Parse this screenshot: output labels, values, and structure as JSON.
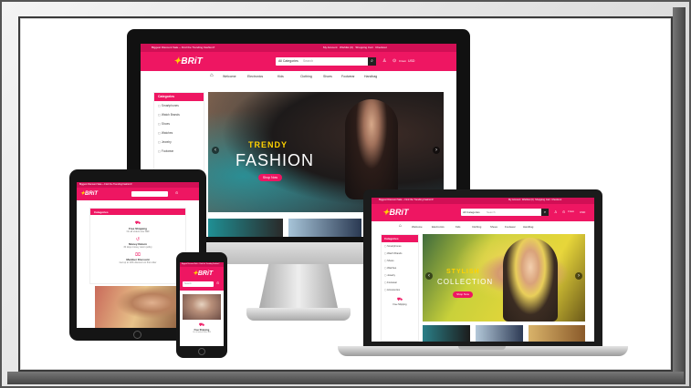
{
  "brand": {
    "logo_text": "BRiT",
    "pink": "#ee1662",
    "yellow": "#ffd200"
  },
  "desktop": {
    "topbar_left": "Biggest Discount Sale ~ Find the Trending Fashion!!",
    "topbar_right": [
      "My Account",
      "Wishlist (0)",
      "Shopping Cart",
      "Checkout"
    ],
    "search_category": "All Categories",
    "search_placeholder": "Search",
    "cart_text": "0 item",
    "currency": "USD",
    "nav": [
      "Home",
      "Welcome",
      "Electronics",
      "Kids",
      "Clothing",
      "Shoes",
      "Footwear",
      "Handbag"
    ],
    "sidebar_title": "Categories",
    "categories": [
      "Smartphones",
      "Watch Brands",
      "Shoes",
      "Watches",
      "Jewelry",
      "Footwear"
    ],
    "hero_line1": "TRENDY",
    "hero_line2": "FASHION",
    "hero_button": "Shop Now"
  },
  "laptop": {
    "topbar_left": "Biggest Discount Sale ~ Find the Trending Fashion!!",
    "topbar_right": [
      "My Account",
      "Wishlist (0)",
      "Shopping Cart",
      "Checkout"
    ],
    "search_category": "All Categories",
    "search_placeholder": "Search",
    "cart_text": "0 item",
    "currency": "USD",
    "nav": [
      "Home",
      "Welcome",
      "Electronics",
      "Kids",
      "Clothing",
      "Shoes",
      "Footwear",
      "Handbag"
    ],
    "sidebar_title": "Categories",
    "categories": [
      "Smartphones",
      "Watch Brands",
      "Shoes",
      "Watches",
      "Jewelry",
      "Footwear",
      "Accessories"
    ],
    "hero_line1": "STYLISH",
    "hero_line2": "COLLECTION",
    "hero_button": "Shop Now",
    "feature": "Free Shipping"
  },
  "tablet": {
    "topbar": "Biggest Discount Sale ~ Find the Trending Fashion!!",
    "sidebar_title": "Categories",
    "features": [
      {
        "title": "Free Shipping",
        "sub": "On all orders over $99"
      },
      {
        "title": "Money Return",
        "sub": "30 days money return policy"
      },
      {
        "title": "Member Discount",
        "sub": "Get up to 10% discount on first order"
      }
    ]
  },
  "phone": {
    "topbar": "Biggest Discount Sale ~ Find the Trending Fashion!!",
    "search_placeholder": "Search",
    "feature_title": "Free Shipping",
    "feature_sub": "On all orders over $99"
  }
}
